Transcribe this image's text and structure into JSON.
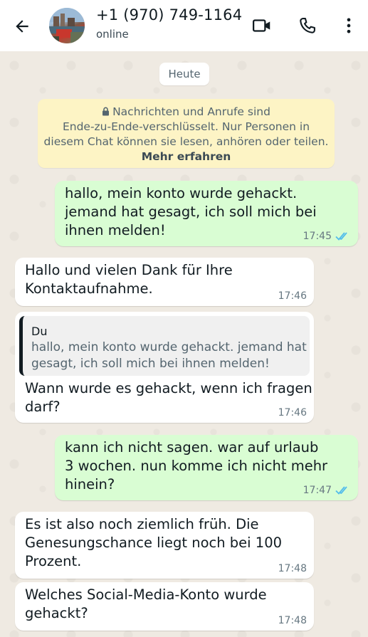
{
  "header": {
    "contact_name": "+1 (970) 749-1164",
    "status": "online"
  },
  "chat": {
    "date_label": "Heute",
    "e2e_notice": {
      "line1": "Nachrichten und Anrufe sind",
      "line2": "Ende-zu-Ende-verschlüsselt. Nur Personen in",
      "line3": "diesem Chat können sie lesen, anhören oder teilen.",
      "link": "Mehr erfahren"
    },
    "messages": [
      {
        "direction": "outgoing",
        "lines": [
          "hallo, mein konto wurde gehackt.",
          "jemand hat gesagt, ich soll mich bei",
          "ihnen melden!"
        ],
        "time": "17:45",
        "read": true
      },
      {
        "direction": "incoming",
        "lines": [
          "Hallo und vielen Dank für Ihre",
          "Kontaktaufnahme."
        ],
        "time": "17:46"
      },
      {
        "direction": "incoming",
        "quote": {
          "author": "Du",
          "lines": [
            "hallo, mein konto wurde gehackt. jemand hat",
            "gesagt, ich soll mich bei ihnen melden!"
          ]
        },
        "lines": [
          "Wann wurde es gehackt, wenn ich fragen",
          "darf?"
        ],
        "time": "17:46"
      },
      {
        "direction": "outgoing",
        "lines": [
          "kann ich nicht sagen. war auf urlaub",
          "3 wochen. nun komme ich nicht mehr",
          "hinein?"
        ],
        "time": "17:47",
        "read": true
      },
      {
        "direction": "incoming",
        "lines": [
          "Es ist also noch ziemlich früh. Die",
          "Genesungschance liegt noch bei 100",
          "Prozent."
        ],
        "time": "17:48"
      },
      {
        "direction": "incoming",
        "lines": [
          "Welches Social-Media-Konto wurde",
          "gehackt?"
        ],
        "time": "17:48"
      }
    ]
  },
  "icons": {
    "back": "arrow-left-icon",
    "video": "video-camera-icon",
    "call": "phone-icon",
    "more": "more-vertical-icon",
    "lock": "lock-icon",
    "read_receipt": "double-check-icon"
  },
  "colors": {
    "outgoing_bubble": "#d9fdd3",
    "incoming_bubble": "#ffffff",
    "read_tick": "#53bdeb",
    "notice_bg": "#fdf4c5",
    "chat_bg": "#efeae2"
  }
}
